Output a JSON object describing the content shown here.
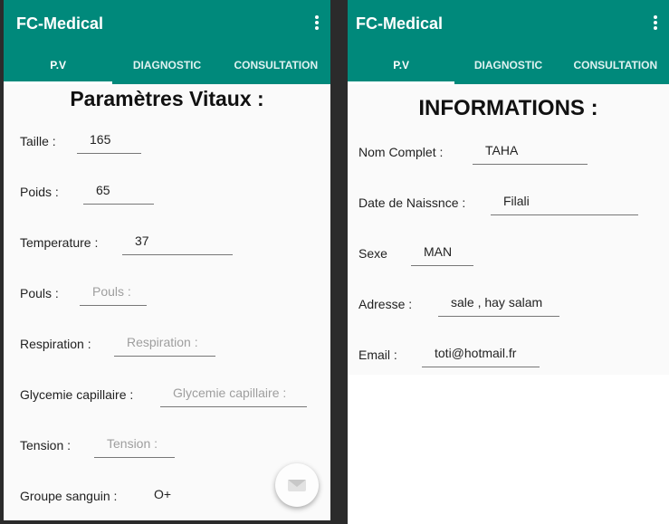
{
  "left": {
    "app_title": "FC-Medical",
    "tabs": [
      "P.V",
      "DIAGNOSTIC",
      "CONSULTATION"
    ],
    "heading": "Paramètres Vitaux :",
    "fields": [
      {
        "label": "Taille :",
        "value": "165",
        "placeholder": ""
      },
      {
        "label": "Poids :",
        "value": "65",
        "placeholder": ""
      },
      {
        "label": "Temperature :",
        "value": "37",
        "placeholder": ""
      },
      {
        "label": "Pouls :",
        "value": "",
        "placeholder": "Pouls :"
      },
      {
        "label": "Respiration :",
        "value": "",
        "placeholder": "Respiration :"
      },
      {
        "label": "Glycemie capillaire :",
        "value": "",
        "placeholder": "Glycemie capillaire :"
      },
      {
        "label": "Tension :",
        "value": "",
        "placeholder": "Tension :"
      },
      {
        "label": "Groupe sanguin :",
        "value": "O+",
        "placeholder": ""
      }
    ],
    "fab_icon": "email-icon"
  },
  "right": {
    "app_title": "FC-Medical",
    "tabs": [
      "P.V",
      "DIAGNOSTIC",
      "CONSULTATION"
    ],
    "heading": "INFORMATIONS :",
    "fields": [
      {
        "label": "Nom Complet :",
        "value": "TAHA"
      },
      {
        "label": "Date de Naissnce :",
        "value": "Filali"
      },
      {
        "label": "Sexe",
        "value": "MAN"
      },
      {
        "label": "Adresse :",
        "value": "sale , hay salam"
      },
      {
        "label": "Email :",
        "value": "toti@hotmail.fr"
      }
    ]
  },
  "colors": {
    "app_bar": "#00897b",
    "background": "#fafafa"
  }
}
